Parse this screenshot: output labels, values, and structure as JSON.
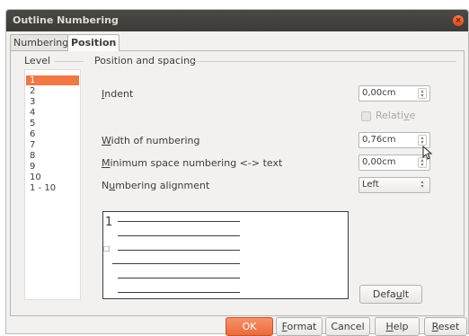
{
  "window": {
    "title": "Outline Numbering",
    "close_glyph": "×"
  },
  "tabs": [
    {
      "label": "Numbering",
      "active": false
    },
    {
      "label": "Position",
      "active": true
    }
  ],
  "level": {
    "label": "Level",
    "items": [
      "1",
      "2",
      "3",
      "4",
      "5",
      "6",
      "7",
      "8",
      "9",
      "10",
      "1 - 10"
    ],
    "selected": "1"
  },
  "position": {
    "label": "Position and spacing",
    "indent": {
      "label_pre": "",
      "mnemonic": "I",
      "label_post": "ndent",
      "value": "0,00cm"
    },
    "relative": {
      "label_pre": "Relati",
      "mnemonic": "v",
      "label_post": "e",
      "checked": false,
      "enabled": false
    },
    "width": {
      "label_pre": "",
      "mnemonic": "W",
      "label_post": "idth of numbering",
      "value": "0,76cm"
    },
    "min_space": {
      "label_pre": "",
      "mnemonic": "M",
      "label_post": "inimum space numbering <-> text",
      "value": "0,00cm"
    },
    "alignment": {
      "label_pre": "N",
      "mnemonic": "u",
      "label_post": "mbering alignment",
      "value": "Left"
    }
  },
  "preview": {
    "number": "1",
    "bullet": "□"
  },
  "buttons": {
    "default": {
      "pre": "Defa",
      "mnemonic": "u",
      "post": "lt"
    },
    "ok": "OK",
    "format": {
      "pre": "",
      "mnemonic": "F",
      "post": "ormat"
    },
    "cancel": "Cancel",
    "help": {
      "pre": "",
      "mnemonic": "H",
      "post": "elp"
    },
    "reset": {
      "pre": "",
      "mnemonic": "R",
      "post": "eset"
    }
  },
  "colors": {
    "accent": "#f07746",
    "titlebar": "#3c3b37"
  }
}
